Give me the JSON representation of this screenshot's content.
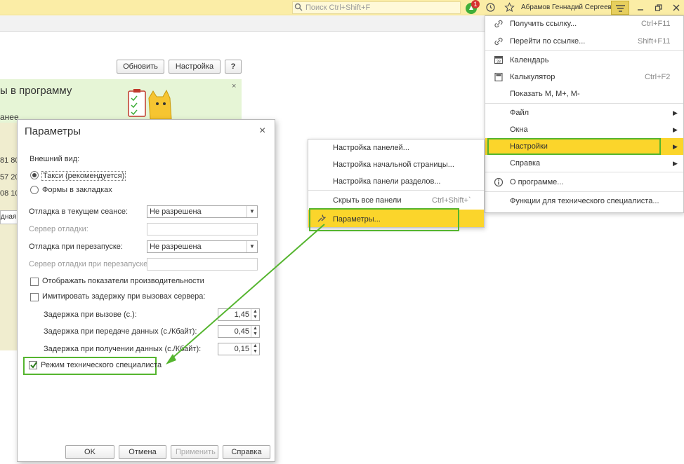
{
  "topbar": {
    "search_placeholder": "Поиск Ctrl+Shift+F",
    "notification_count": "1",
    "user_name": "Абрамов Геннадий Сергеевич"
  },
  "background_form": {
    "refresh_label": "Обновить",
    "settings_label": "Настройка",
    "help_label": "?",
    "banner_title": "ы в программу",
    "banner_sub": "анее",
    "banner_close": "×",
    "numbers": [
      "81 80",
      "57 20",
      "08 10"
    ],
    "partial_field": "дная"
  },
  "dialog": {
    "title": "Параметры",
    "close": "×",
    "appearance_label": "Внешний вид:",
    "radio_taxi": "Такси (рекомендуется)",
    "radio_tabs": "Формы в закладках",
    "debug_session_label": "Отладка в текущем сеансе:",
    "debug_session_value": "Не разрешена",
    "debug_server_label": "Сервер отладки:",
    "debug_restart_label": "Отладка при перезапуске:",
    "debug_restart_value": "Не разрешена",
    "debug_restart_server_label": "Сервер отладки при перезапуске:",
    "perf_label": "Отображать показатели производительности",
    "imitate_label": "Имитировать задержку при вызовах сервера:",
    "delay_call_label": "Задержка при вызове (с.):",
    "delay_call_value": "1,45",
    "delay_send_label": "Задержка при передаче данных (с./Кбайт):",
    "delay_send_value": "0,45",
    "delay_recv_label": "Задержка при получении данных (с./Кбайт):",
    "delay_recv_value": "0,15",
    "tech_mode_label": "Режим технического специалиста",
    "ok": "OK",
    "cancel": "Отмена",
    "apply": "Применить",
    "help": "Справка"
  },
  "main_menu": {
    "get_link": "Получить ссылку...",
    "get_link_sc": "Ctrl+F11",
    "go_link": "Перейти по ссылке...",
    "go_link_sc": "Shift+F11",
    "calendar": "Календарь",
    "calculator": "Калькулятор",
    "calculator_sc": "Ctrl+F2",
    "show_m": "Показать M, M+, M-",
    "file": "Файл",
    "windows": "Окна",
    "settings": "Настройки",
    "help": "Справка",
    "about": "О программе...",
    "tech_functions": "Функции для технического специалиста..."
  },
  "submenu": {
    "panels": "Настройка панелей...",
    "home_page": "Настройка начальной страницы...",
    "sections_panel": "Настройка панели разделов...",
    "hide_panels": "Скрыть все панели",
    "hide_panels_sc": "Ctrl+Shift+`",
    "parameters": "Параметры..."
  },
  "colors": {
    "highlight_yellow": "#fbd52b",
    "annotation_green": "#55b52f",
    "topbar": "#fbeda6"
  }
}
